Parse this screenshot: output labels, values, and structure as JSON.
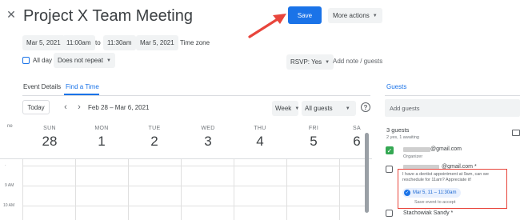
{
  "header": {
    "title": "Project X Team Meeting",
    "save_label": "Save",
    "more_actions_label": "More actions"
  },
  "datetime": {
    "start_date": "Mar 5, 2021",
    "start_time": "11:00am",
    "to_label": "to",
    "end_time": "11:30am",
    "end_date": "Mar 5, 2021",
    "time_zone_label": "Time zone",
    "all_day_label": "All day",
    "repeat_value": "Does not repeat"
  },
  "rsvp": {
    "value": "RSVP: Yes",
    "add_note_label": "Add note / guests"
  },
  "tabs": {
    "event_details": "Event Details",
    "find_a_time": "Find a Time"
  },
  "calendar_toolbar": {
    "today_label": "Today",
    "date_range": "Feb 28 – Mar 6, 2021",
    "view_value": "Week",
    "guests_filter_value": "All guests",
    "help_icon": "help-icon"
  },
  "days": [
    {
      "dow": "SUN",
      "num": "28"
    },
    {
      "dow": "MON",
      "num": "1"
    },
    {
      "dow": "TUE",
      "num": "2"
    },
    {
      "dow": "WED",
      "num": "3"
    },
    {
      "dow": "THU",
      "num": "4"
    },
    {
      "dow": "FRI",
      "num": "5"
    },
    {
      "dow": "SA",
      "num": "6"
    }
  ],
  "time_gutter": {
    "top_label": "ne",
    "row1": "9 AM",
    "row2": "10 AM"
  },
  "guests": {
    "heading": "Guests",
    "add_placeholder": "Add guests",
    "count_label": "3 guests",
    "summary": "2 yes, 1 awaiting",
    "guest1_email": "@gmail.com",
    "guest1_role": "Organizer",
    "guest2_email": "@gmail.com *",
    "guest2_message": "I have a dentist appointment at 9am, can we reschedule for 11am? Appreciate it!",
    "guest2_proposal": "Mar 5, 11 – 11:30am",
    "guest2_save_hint": "Save event to accept",
    "guest3_name": "Stachowiak Sandy *"
  },
  "colors": {
    "accent": "#1a73e8",
    "annotation_red": "#e8453c",
    "check_green": "#34a853"
  }
}
